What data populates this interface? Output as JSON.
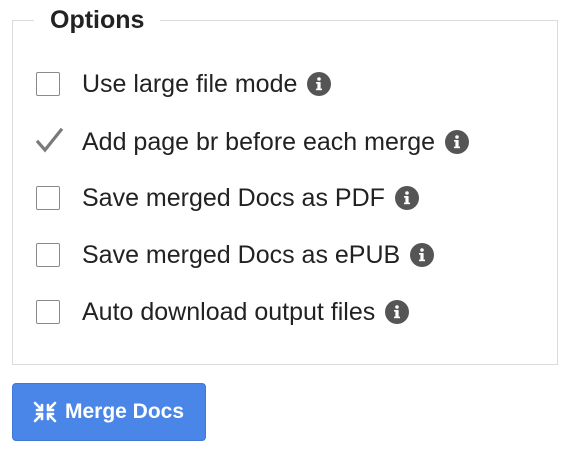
{
  "options": {
    "title": "Options",
    "items": [
      {
        "label": "Use large file mode",
        "checked": false,
        "info_icon": "info-icon"
      },
      {
        "label": "Add page br before each merge",
        "checked": true,
        "info_icon": "info-icon"
      },
      {
        "label": "Save merged Docs as PDF",
        "checked": false,
        "info_icon": "info-icon"
      },
      {
        "label": "Save merged Docs as ePUB",
        "checked": false,
        "info_icon": "info-icon"
      },
      {
        "label": "Auto download output files",
        "checked": false,
        "info_icon": "info-icon"
      }
    ]
  },
  "merge_button": {
    "label": "Merge Docs",
    "icon": "merge-icon",
    "color": "#4a86e8"
  },
  "colors": {
    "text": "#222222",
    "info_icon_bg": "#555555",
    "border": "#dcdcdc"
  }
}
